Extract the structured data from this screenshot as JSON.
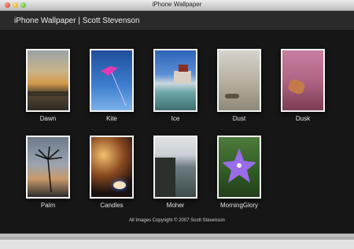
{
  "window": {
    "title": "iPhone Wallpaper"
  },
  "header": {
    "title": "iPhone Wallpaper | Scott Stevenson"
  },
  "gallery": [
    {
      "label": "Dawn",
      "icon": "photo-dawn"
    },
    {
      "label": "Kite",
      "icon": "photo-kite"
    },
    {
      "label": "Ice",
      "icon": "photo-ice"
    },
    {
      "label": "Dust",
      "icon": "photo-dust"
    },
    {
      "label": "Dusk",
      "icon": "photo-dusk"
    },
    {
      "label": "Palm",
      "icon": "photo-palm"
    },
    {
      "label": "Candles",
      "icon": "photo-candles"
    },
    {
      "label": "Moher",
      "icon": "photo-moher"
    },
    {
      "label": "MorningGlory",
      "icon": "photo-morningglory"
    }
  ],
  "footer": {
    "copyright": "All Images Copyright © 2007 Scott Stevenson"
  }
}
